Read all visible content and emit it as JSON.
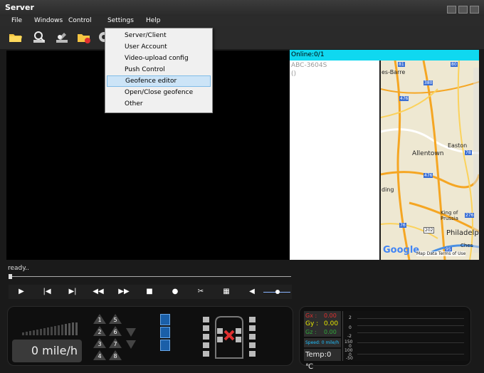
{
  "window": {
    "title": "Server"
  },
  "menu": [
    "File",
    "Windows",
    "Control",
    "Settings",
    "Help"
  ],
  "settings_menu": {
    "items": [
      "Server/Client",
      "User Account",
      "Video-upload config",
      "Push Control",
      "Geofence editor",
      "Open/Close geofence",
      "Other"
    ],
    "highlighted": "Geofence editor"
  },
  "device_panel": {
    "online": "Online:0/1",
    "device": "ABC-3604S",
    "device_sub": "()"
  },
  "map": {
    "labels": [
      "es-Barre",
      "Easton",
      "Allentown",
      "ding",
      "King of Prussia",
      "Philadelp",
      "Ches"
    ],
    "route_numbers": [
      "81",
      "80",
      "380",
      "476",
      "78",
      "476",
      "76",
      "276",
      "202",
      "95"
    ],
    "brand": "Google",
    "footer": "Map Data  Terms of Use"
  },
  "status": {
    "text": "ready.."
  },
  "playback": {
    "buttons": [
      "play",
      "previous",
      "next",
      "rewind",
      "fast-forward",
      "stop",
      "record",
      "cut",
      "grid",
      "volume"
    ]
  },
  "dashboard": {
    "speed": "0 mile/h",
    "channels": [
      "1",
      "5",
      "2",
      "6",
      "3",
      "7",
      "4",
      "8"
    ]
  },
  "sensor": {
    "gx_label": "Gx :",
    "gx_value": "0.00",
    "gy_label": "Gy :",
    "gy_value": "0.00",
    "gz_label": "Gz :",
    "gz_value": "0.00",
    "speed": "Speed: 0 mile/h",
    "temp": "Temp:0 ℃",
    "scale": [
      "2",
      "0",
      "-2",
      "150",
      "0",
      "100",
      "0",
      "-50"
    ]
  },
  "colors": {
    "online_bar": "#0fd8f0",
    "highlight": "#cce4f7",
    "gx": "#e03030",
    "gy": "#e6e600",
    "gz": "#2fa83a",
    "speed_text": "#1fc0ff"
  }
}
